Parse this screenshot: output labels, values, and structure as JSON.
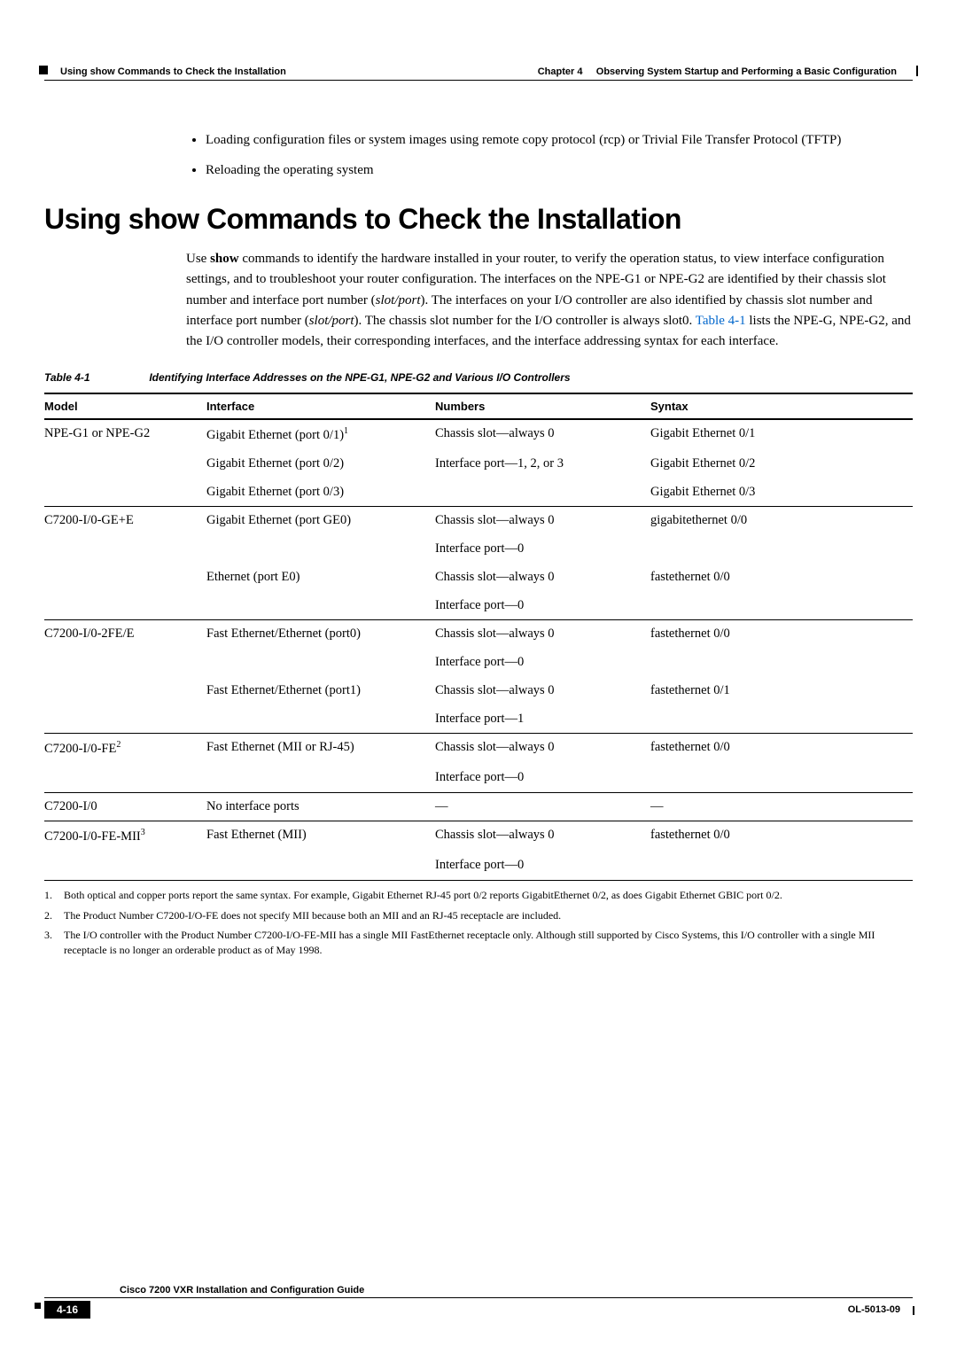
{
  "runningHeader": {
    "left": "Using show Commands to Check the Installation",
    "rightPrefix": "Chapter 4",
    "rightTitle": "Observing System Startup and Performing a Basic Configuration"
  },
  "bullets": [
    "Loading configuration files or system images using remote copy protocol (rcp) or Trivial File Transfer Protocol (TFTP)",
    "Reloading the operating system"
  ],
  "heading": "Using show Commands to Check the Installation",
  "para": {
    "p1a": "Use ",
    "p1cmd": "show",
    "p1b": " commands to identify the hardware installed in your router, to verify the operation status, to view interface configuration settings, and to troubleshoot your router configuration. The interfaces on the NPE-G1 or NPE-G2 are identified by their chassis slot number and interface port number (",
    "p1ital1": "slot/port",
    "p1c": "). The interfaces on your I/O controller are also identified by chassis slot number and interface port number (",
    "p1ital2": "slot/port",
    "p1d": "). The chassis slot number for the I/O controller is always slot0. ",
    "p1link": "Table 4-1",
    "p1e": " lists the NPE-G, NPE-G2, and the I/O controller models, their corresponding interfaces, and the interface addressing syntax for each interface."
  },
  "tableCaption": {
    "num": "Table 4-1",
    "text": "Identifying Interface Addresses on the NPE-G1, NPE-G2 and Various I/O Controllers"
  },
  "tableHeaders": {
    "model": "Model",
    "interface": "Interface",
    "numbers": "Numbers",
    "syntax": "Syntax"
  },
  "rows": [
    {
      "sep": true,
      "model": "NPE-G1 or NPE-G2",
      "interfacePre": "Gigabit Ethernet (port 0/1)",
      "sup": "1",
      "numbers": "Chassis slot—always 0",
      "syntax": "Gigabit Ethernet 0/1"
    },
    {
      "model": "",
      "interface": "Gigabit Ethernet (port 0/2)",
      "numbers": "Interface port—1, 2, or 3",
      "syntax": "Gigabit Ethernet 0/2"
    },
    {
      "model": "",
      "interface": "Gigabit Ethernet (port 0/3)",
      "numbers": "",
      "syntax": "Gigabit Ethernet 0/3"
    },
    {
      "sep": true,
      "model": "C7200-I/0-GE+E",
      "interface": "Gigabit Ethernet (port GE0)",
      "numbers": "Chassis slot—always 0",
      "syntax": "gigabitethernet 0/0"
    },
    {
      "model": "",
      "interface": "",
      "numbers": "Interface port—0",
      "syntax": ""
    },
    {
      "model": "",
      "interface": "Ethernet (port E0)",
      "numbers": "Chassis slot—always 0",
      "syntax": "fastethernet 0/0"
    },
    {
      "model": "",
      "interface": "",
      "numbers": "Interface port—0",
      "syntax": ""
    },
    {
      "sep": true,
      "model": "C7200-I/0-2FE/E",
      "interface": "Fast Ethernet/Ethernet (port0)",
      "numbers": "Chassis slot—always 0",
      "syntax": "fastethernet 0/0"
    },
    {
      "model": "",
      "interface": "",
      "numbers": "Interface port—0",
      "syntax": ""
    },
    {
      "model": "",
      "interface": "Fast Ethernet/Ethernet (port1)",
      "numbers": "Chassis slot—always 0",
      "syntax": "fastethernet 0/1"
    },
    {
      "model": "",
      "interface": "",
      "numbers": "Interface port—1",
      "syntax": ""
    },
    {
      "sep": true,
      "modelPre": "C7200-I/0-FE",
      "sup": "2",
      "interface": "Fast Ethernet (MII or RJ-45)",
      "numbers": "Chassis slot—always 0",
      "syntax": "fastethernet 0/0"
    },
    {
      "model": "",
      "interface": "",
      "numbers": "Interface port—0",
      "syntax": ""
    },
    {
      "sep": true,
      "model": "C7200-I/0",
      "interface": "No interface ports",
      "numbers": "—",
      "syntax": "—"
    },
    {
      "sep": true,
      "modelPre": "C7200-I/0-FE-MII",
      "sup": "3",
      "interface": "Fast Ethernet (MII)",
      "numbers": "Chassis slot—always 0",
      "syntax": "fastethernet 0/0"
    },
    {
      "last": true,
      "model": "",
      "interface": "",
      "numbers": "Interface port—0",
      "syntax": ""
    }
  ],
  "footnotes": [
    {
      "num": "1.",
      "text": "Both optical and copper ports report the same syntax. For example, Gigabit Ethernet RJ-45 port 0/2 reports GigabitEthernet 0/2, as does Gigabit Ethernet GBIC port 0/2."
    },
    {
      "num": "2.",
      "text": "The Product Number C7200-I/O-FE does not specify MII because both an MII and an RJ-45 receptacle are included."
    },
    {
      "num": "3.",
      "text": "The I/O controller with the Product Number C7200-I/O-FE-MII has a single MII FastEthernet receptacle only. Although still supported by Cisco Systems, this I/O controller with a single MII receptacle is no longer an orderable product as of May 1998."
    }
  ],
  "runningFooter": {
    "title": "Cisco 7200 VXR Installation and Configuration Guide",
    "page": "4-16",
    "doc": "OL-5013-09"
  }
}
